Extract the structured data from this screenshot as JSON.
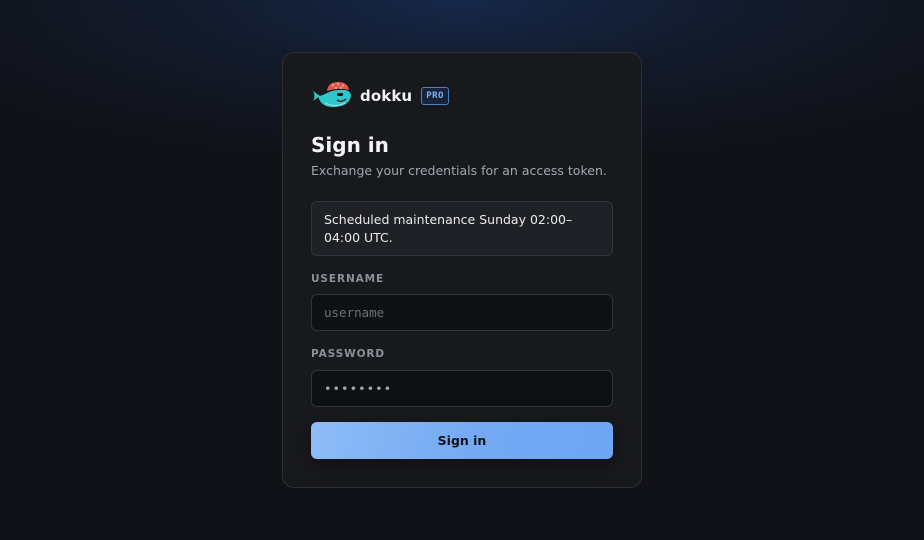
{
  "brand": {
    "name": "dokku",
    "badge": "PRO",
    "logo_icon": "whale-logo-icon"
  },
  "form": {
    "title": "Sign in",
    "subtitle": "Exchange your credentials for an access token.",
    "notice": "Scheduled maintenance Sunday 02:00–04:00 UTC.",
    "username_label": "USERNAME",
    "username_placeholder": "username",
    "username_value": "",
    "password_label": "PASSWORD",
    "password_value": "••••••••",
    "submit_label": "Sign in"
  },
  "colors": {
    "accent": "#74a9f3",
    "background": "#111217",
    "card": "#18191d",
    "logo_whale": "#2fc7c9",
    "logo_hat": "#e0574f"
  }
}
